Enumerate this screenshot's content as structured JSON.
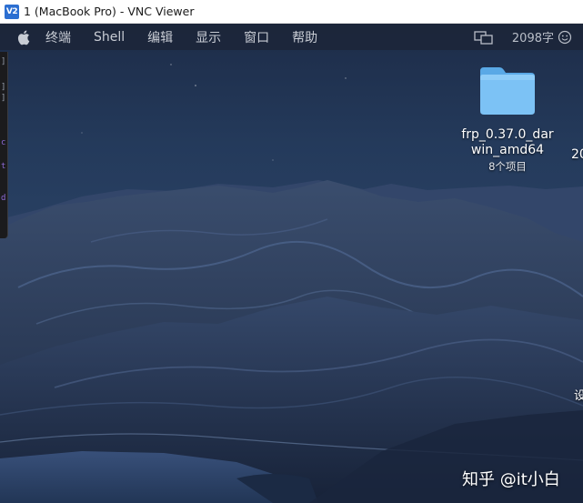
{
  "window": {
    "app_icon_text": "V2",
    "title": "1 (MacBook Pro) - VNC Viewer"
  },
  "menubar": {
    "items": [
      "终端",
      "Shell",
      "编辑",
      "显示",
      "窗口",
      "帮助"
    ],
    "word_count": "2098字",
    "icons": [
      "apple-icon",
      "screens-icon",
      "smiley-icon"
    ]
  },
  "desktop": {
    "folder": {
      "name_line1": "frp_0.37.0_dar",
      "name_line2": "win_amd64",
      "subtitle": "8个项目",
      "icon": "folder-icon"
    },
    "clipped_label": "20",
    "clipped_char": "设",
    "side_window_glyphs": [
      "]",
      "]",
      "]",
      "c",
      "t",
      "d"
    ]
  },
  "watermark": "知乎 @it小白",
  "colors": {
    "folder": "#7cc2f5",
    "menubar_text": "#c8ccd4",
    "sky_top": "#1a2a45",
    "mountains": "#2b3a55"
  }
}
